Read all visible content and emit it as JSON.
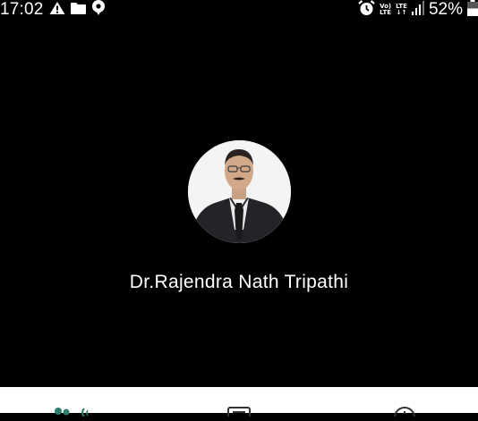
{
  "status_bar": {
    "time": "17:02",
    "left_icons": [
      "warning-icon",
      "folder-icon",
      "chat-bubble-icon"
    ],
    "network": {
      "volte_top": "Vo)",
      "volte_bottom": "LTE",
      "data_top": "LTE",
      "data_bottom": "↓↑"
    },
    "battery_percent": "52%",
    "right_icons": [
      "alarm-icon",
      "signal-icon",
      "battery-icon"
    ]
  },
  "contact": {
    "name": "Dr.Rajendra Nath Tripathi",
    "photo": "contact-photo"
  },
  "bottom_nav": {
    "items": [
      "contacts-icon",
      "notes-icon",
      "info-icon"
    ]
  },
  "colors": {
    "background": "#000000",
    "text": "#ffffff",
    "nav_background": "#ffffff",
    "nav_accent": "#2e7d6b"
  }
}
